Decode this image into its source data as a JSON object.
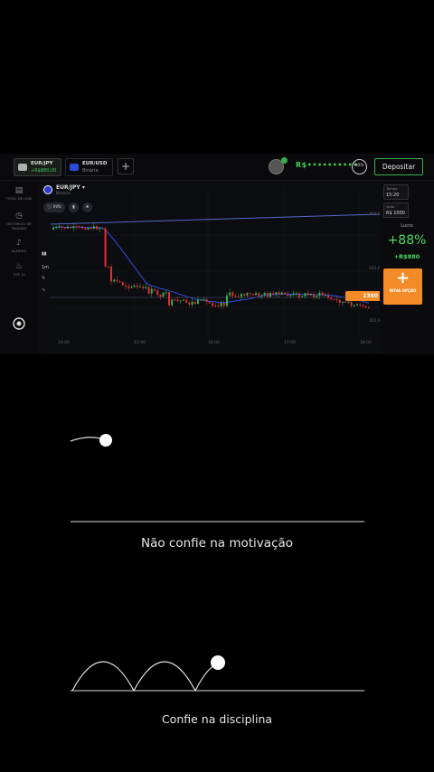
{
  "topbar": {
    "tabs": [
      {
        "name": "EUR/JPY",
        "sub": "+R$880,00"
      },
      {
        "name": "EUR/USD",
        "sub": "Binária"
      }
    ],
    "add_label": "+",
    "balance": "R$••••••••••",
    "percent": "90%",
    "deposit_label": "Depositar"
  },
  "sidebar": {
    "items": [
      {
        "icon": "briefcase-icon",
        "label": "TOTAL DE HOJE"
      },
      {
        "icon": "clock-icon",
        "label": "HISTÓRICO DE TRADING"
      },
      {
        "icon": "bell-icon",
        "label": "ALERTAS"
      },
      {
        "icon": "fire-icon",
        "label": "TOP 10"
      }
    ]
  },
  "chart": {
    "asset_name": "EUR/JPY ▾",
    "asset_sub": "Binária",
    "info_label": "Info",
    "price_tag": "2360",
    "timeframe": "1m",
    "time_labels": [
      "14:00",
      "15:00",
      "16:00",
      "17:00",
      "18:00"
    ],
    "price_labels": [
      "162.0",
      "161.9",
      "161.8"
    ]
  },
  "right_panel": {
    "time_title": "Tempo",
    "time_value": "15:20",
    "amount_title": "Valor",
    "amount_value": "R$ 1000",
    "profit_label": "Lucro",
    "profit_percent": "+88%",
    "profit_amount": "+R$880",
    "new_option_label": "NOVA OPÇÃO"
  },
  "captions": {
    "top": "Não confie na motivação",
    "bottom": "Confie na disciplina"
  },
  "colors": {
    "accent": "#f28b28",
    "profit": "#4cd964",
    "up": "#37b24d",
    "down": "#e03131"
  }
}
